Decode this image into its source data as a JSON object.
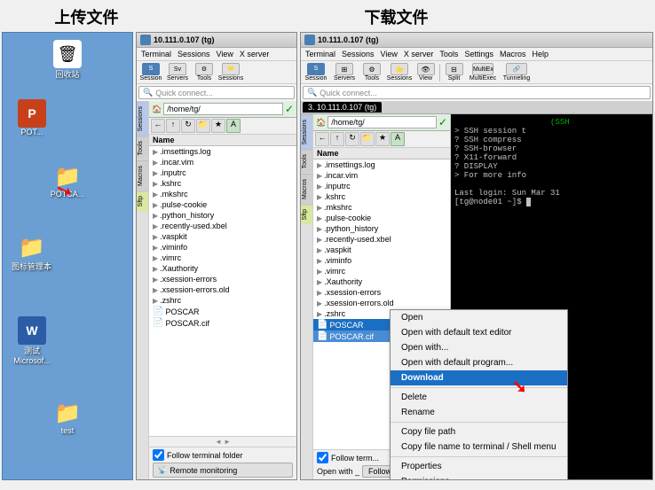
{
  "labels": {
    "upload": "上传文件",
    "download": "下载文件"
  },
  "left_window": {
    "title": "10.111.0.107 (tg)",
    "menus": [
      "Terminal",
      "Sessions",
      "View",
      "X server"
    ],
    "quick_connect": "Quick connect...",
    "path": "/home/tg/",
    "files": [
      ".imsettings.log",
      ".incar.vim",
      ".inputrc",
      ".kshrc",
      ".mkshrc",
      ".pulse-cookie",
      ".python_history",
      ".recently-used.xbel",
      ".vaspkit",
      ".viminfo",
      ".vimrc",
      ".Xauthority",
      ".xsession-errors",
      ".xsession-errors.old",
      ".zshrc",
      "POSCAR",
      "POSCAR.cif"
    ],
    "side_tabs": [
      "Sessions",
      "Tools",
      "Macros",
      "Sftp"
    ],
    "follow_label": "Follow terminal folder",
    "remote_btn": "Remote monitoring"
  },
  "right_window": {
    "title": "10.111.0.107 (tg)",
    "menus": [
      "Terminal",
      "Sessions",
      "View",
      "X server",
      "Tools",
      "Settings",
      "Macros",
      "Help"
    ],
    "toolbar_items": [
      "Session",
      "Servers",
      "Tools",
      "Sessions",
      "View",
      "Split",
      "MultiExec",
      "Tunneling"
    ],
    "quick_connect": "Quick connect...",
    "path": "/home/tg/",
    "tab": "3. 10.111.0.107 (tg)",
    "files": [
      ".imsettings.log",
      ".incar.vim",
      ".inputrc",
      ".kshrc",
      ".mkshrc",
      ".pulse-cookie",
      ".python_history",
      ".recently-used.xbel",
      ".vaspkit",
      ".viminfo",
      ".vimrc",
      ".Xauthority",
      ".xsession-errors",
      ".xsession-errors.old",
      ".zshrc",
      "POSCAR",
      "POSCAR.cif"
    ],
    "selected_files": [
      "POSCAR",
      "POSCAR.cif"
    ],
    "terminal_lines": [
      "                    (SSH",
      "> SSH session t",
      "? SSH compress",
      "? SSH-browser",
      "? X11-forward",
      "? DISPLAY",
      "> For more info",
      "",
      "Last login: Sun Mar 31",
      "[tg@node01 ~]$"
    ],
    "context_menu": {
      "items": [
        {
          "label": "Open",
          "highlighted": false
        },
        {
          "label": "Open with default text editor",
          "highlighted": false
        },
        {
          "label": "Open with...",
          "highlighted": false
        },
        {
          "label": "Open with default program...",
          "highlighted": false
        },
        {
          "label": "Download",
          "highlighted": true
        },
        {
          "label": "Delete",
          "highlighted": false
        },
        {
          "label": "Rename",
          "highlighted": false
        },
        {
          "label": "Copy file path",
          "highlighted": false
        },
        {
          "label": "Copy file name to terminal / Shell menu",
          "highlighted": false
        },
        {
          "label": "Properties",
          "highlighted": false
        },
        {
          "label": "Permissions",
          "highlighted": false
        }
      ]
    },
    "follow_label": "Follow term...",
    "open_with_label": "Open with _",
    "follow_btn": "Follow"
  },
  "icons": {
    "recycle": "🗑",
    "folder": "📁",
    "ppt": "📊",
    "word": "📄",
    "computer": "💻"
  }
}
